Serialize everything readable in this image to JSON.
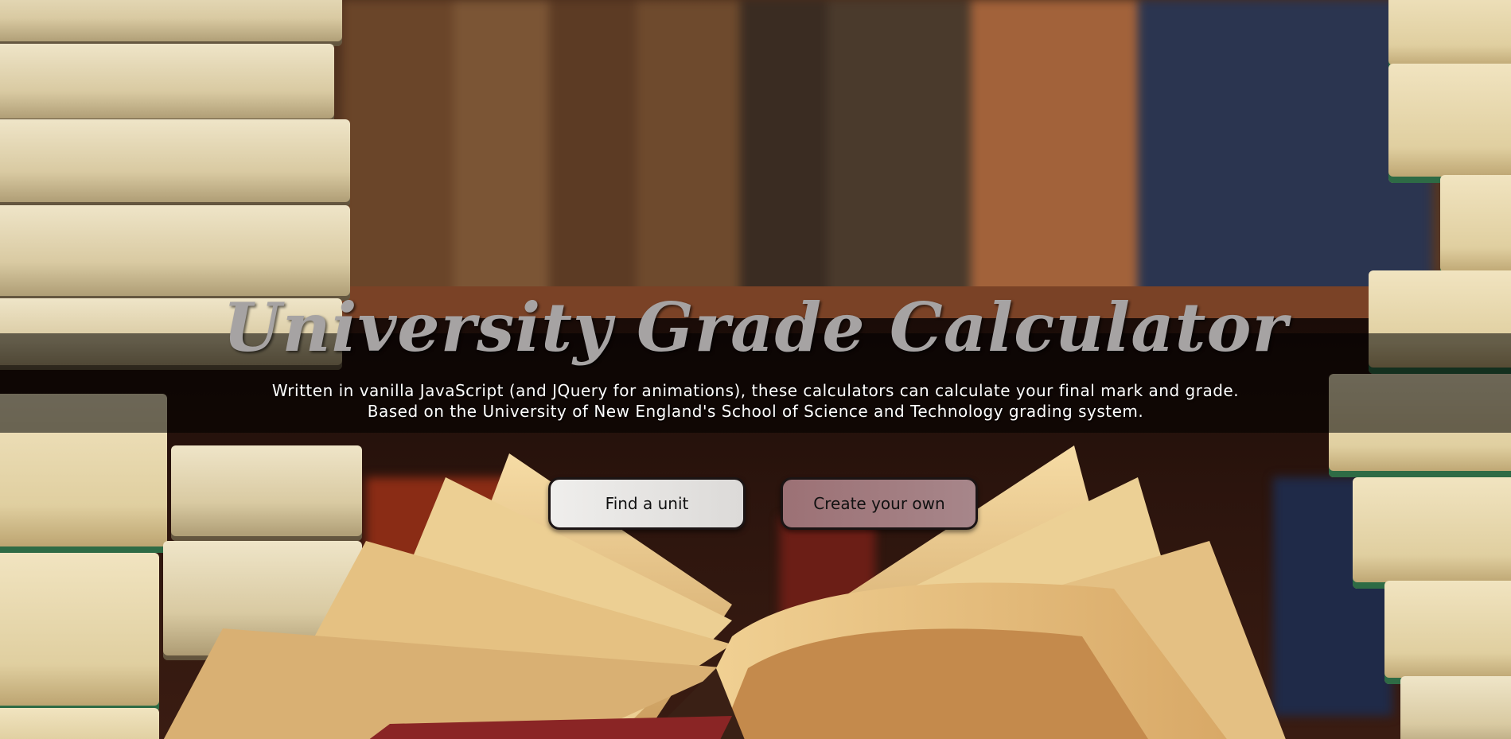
{
  "hero": {
    "title": "University Grade Calculator",
    "subtitle_line1": "Written in vanilla JavaScript (and JQuery for animations), these calculators can calculate your final mark and grade.",
    "subtitle_line2": "Based on the University of New England's School of Science and Technology grading system."
  },
  "actions": {
    "find_unit_label": "Find a unit",
    "create_own_label": "Create your own"
  },
  "colors": {
    "title": "#a6a3a3",
    "band": "#000000",
    "find_button": "#e6e5e3",
    "create_button": "#a07a7e"
  }
}
